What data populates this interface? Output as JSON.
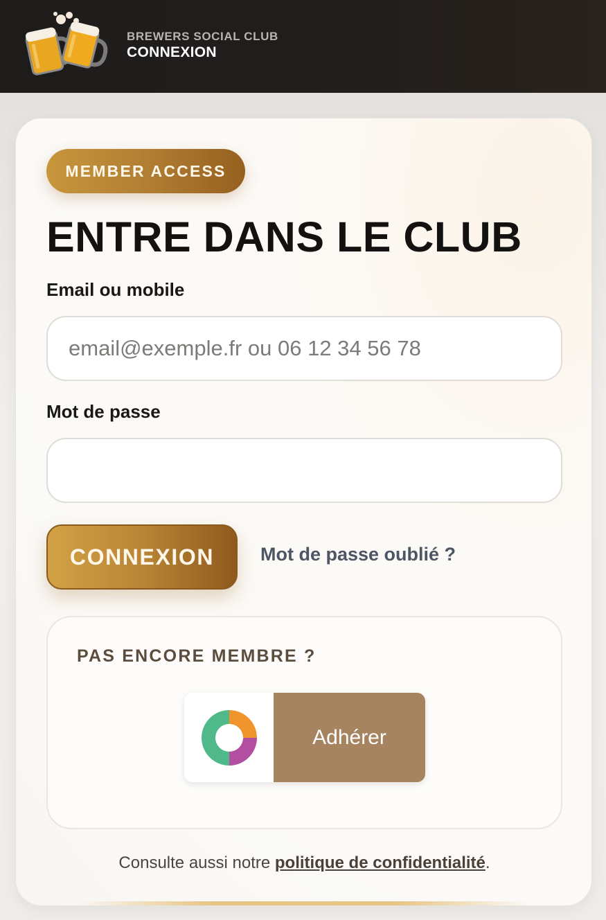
{
  "header": {
    "brand": "BREWERS SOCIAL CLUB",
    "page_title": "CONNEXION",
    "logo_icon": "beer-mugs-cheers-icon"
  },
  "card": {
    "badge": "MEMBER ACCESS",
    "title": "ENTRE DANS LE CLUB",
    "email_label": "Email ou mobile",
    "email_placeholder": "email@exemple.fr ou 06 12 34 56 78",
    "email_value": "",
    "password_label": "Mot de passe",
    "password_value": "",
    "submit_label": "CONNEXION",
    "forgot_link": "Mot de passe oublié ?",
    "join": {
      "title": "PAS ENCORE MEMBRE ?",
      "button_label": "Adhérer",
      "button_icon": "partner-circle-play-logo-icon"
    },
    "footer": {
      "prefix": "Consulte aussi notre ",
      "link": "politique de confidentialité",
      "suffix": "."
    }
  },
  "colors": {
    "header_bg": "#1e1c1b",
    "accent_gold": "#b98536",
    "join_button_bg": "#a5845f",
    "link_gray": "#4e5564"
  }
}
